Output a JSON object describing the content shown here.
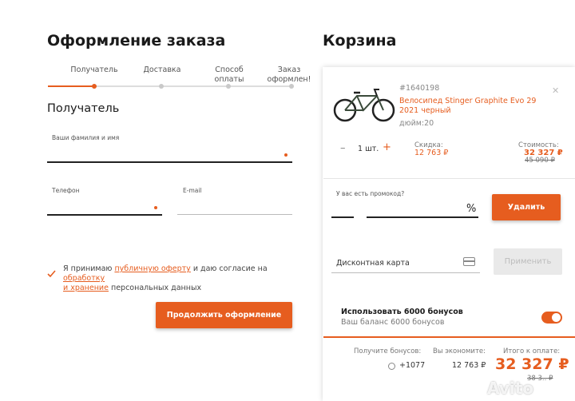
{
  "checkout": {
    "title": "Оформление заказа",
    "steps": [
      "Получатель",
      "Доставка",
      "Способ\nоплаты",
      "Заказ\nоформлен!"
    ],
    "section_title": "Получатель",
    "fields": {
      "name_label": "Ваши фамилия и имя",
      "phone_label": "Телефон",
      "email_label": "E-mail"
    },
    "consent": {
      "prefix": "Я принимаю ",
      "offer_link": "публичную оферту",
      "middle": " и даю согласие на ",
      "processing_link_1": "обработку",
      "processing_link_2": "и хранение",
      "suffix": " персональных данных"
    },
    "continue_button": "Продолжить оформление"
  },
  "cart": {
    "title": "Корзина",
    "product": {
      "sku": "#1640198",
      "name_line1": "Велосипед Stinger Graphite Evo 29",
      "name_line2": "2021 черный",
      "size": "дюйм:20",
      "qty": "1 шт.",
      "minus": "–",
      "plus": "+",
      "discount_label": "Скидка:",
      "discount_value": "12 763 ₽",
      "cost_label": "Стоимость:",
      "cost_value": "32 327 ₽",
      "old_price": "45 090 ₽"
    },
    "promo": {
      "label": "У вас есть промокод?",
      "percent": "%",
      "delete_button": "Удалить"
    },
    "discount_card": {
      "label": "Дисконтная карта",
      "apply_button": "Применить"
    },
    "bonuses": {
      "use_label": "Использовать 6000 бонусов",
      "balance": "Ваш баланс 6000 бонусов",
      "toggle_on": true
    },
    "summary": {
      "receive_label": "Получите бонусов:",
      "receive_value": "+1077",
      "save_label": "Вы экономите:",
      "save_value": "12 763 ₽",
      "total_label": "Итого к оплате:",
      "total_value": "32 327 ₽",
      "total_old": "38 3.. ₽"
    },
    "watermark": "Avito"
  },
  "colors": {
    "accent": "#e65d1f"
  }
}
